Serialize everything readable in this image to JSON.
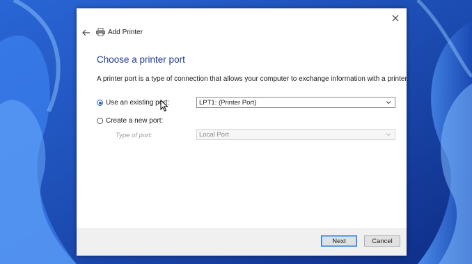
{
  "dialog": {
    "title": "Add Printer",
    "heading": "Choose a printer port",
    "description": "A printer port is a type of connection that allows your computer to exchange information with a printer.",
    "options": {
      "existing_label": "Use an existing port:",
      "existing_selected": true,
      "existing_value": "LPT1: (Printer Port)",
      "new_label": "Create a new port:",
      "new_selected": false,
      "type_label": "Type of port:",
      "type_value": "Local Port"
    },
    "buttons": {
      "next": "Next",
      "cancel": "Cancel"
    }
  },
  "icons": {
    "back": "back-arrow-icon",
    "close": "close-icon",
    "printer": "printer-icon",
    "dropdown": "chevron-down-icon"
  },
  "colors": {
    "heading": "#1e3a8c",
    "accent": "#1d5fbf",
    "wallpaper": "#1b4fb8"
  }
}
